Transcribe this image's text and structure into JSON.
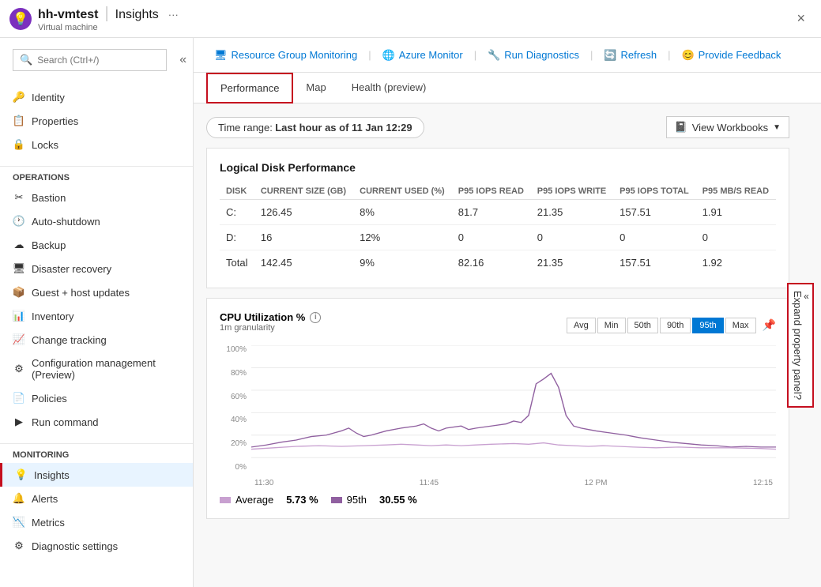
{
  "titleBar": {
    "iconChar": "💡",
    "resourceName": "hh-vmtest",
    "pageName": "Insights",
    "subTitle": "Virtual machine",
    "dotsLabel": "···",
    "closeLabel": "×"
  },
  "sidebar": {
    "searchPlaceholder": "Search (Ctrl+/)",
    "collapseLabel": "«",
    "topItems": [
      {
        "id": "identity",
        "label": "Identity",
        "icon": "🔑"
      },
      {
        "id": "properties",
        "label": "Properties",
        "icon": "📋"
      },
      {
        "id": "locks",
        "label": "Locks",
        "icon": "🔒"
      }
    ],
    "operations": {
      "title": "Operations",
      "items": [
        {
          "id": "bastion",
          "label": "Bastion",
          "icon": "⚙"
        },
        {
          "id": "auto-shutdown",
          "label": "Auto-shutdown",
          "icon": "🕐"
        },
        {
          "id": "backup",
          "label": "Backup",
          "icon": "☁"
        },
        {
          "id": "disaster-recovery",
          "label": "Disaster recovery",
          "icon": "🖥"
        },
        {
          "id": "guest-updates",
          "label": "Guest + host updates",
          "icon": "📦"
        },
        {
          "id": "inventory",
          "label": "Inventory",
          "icon": "📊"
        },
        {
          "id": "change-tracking",
          "label": "Change tracking",
          "icon": "📈"
        },
        {
          "id": "config-management",
          "label": "Configuration management (Preview)",
          "icon": "⚙"
        },
        {
          "id": "policies",
          "label": "Policies",
          "icon": "📄"
        },
        {
          "id": "run-command",
          "label": "Run command",
          "icon": "▶"
        }
      ]
    },
    "monitoring": {
      "title": "Monitoring",
      "items": [
        {
          "id": "insights",
          "label": "Insights",
          "icon": "💡",
          "active": true
        },
        {
          "id": "alerts",
          "label": "Alerts",
          "icon": "🔔"
        },
        {
          "id": "metrics",
          "label": "Metrics",
          "icon": "📉"
        },
        {
          "id": "diagnostic-settings",
          "label": "Diagnostic settings",
          "icon": "⚙"
        }
      ]
    }
  },
  "topNav": {
    "items": [
      {
        "id": "resource-group-monitoring",
        "label": "Resource Group Monitoring",
        "icon": "🖥"
      },
      {
        "id": "azure-monitor",
        "label": "Azure Monitor",
        "icon": "🌐"
      },
      {
        "id": "run-diagnostics",
        "label": "Run Diagnostics",
        "icon": "🔧"
      },
      {
        "id": "refresh",
        "label": "Refresh",
        "icon": "🔄"
      },
      {
        "id": "provide-feedback",
        "label": "Provide Feedback",
        "icon": "😊"
      }
    ]
  },
  "tabs": [
    {
      "id": "performance",
      "label": "Performance",
      "active": true
    },
    {
      "id": "map",
      "label": "Map",
      "active": false
    },
    {
      "id": "health",
      "label": "Health (preview)",
      "active": false
    }
  ],
  "timeRange": {
    "label": "Time range:",
    "value": "Last hour as of 11 Jan 12:29"
  },
  "viewWorkbooks": {
    "label": "View Workbooks"
  },
  "diskTable": {
    "title": "Logical Disk Performance",
    "columns": [
      "DISK",
      "CURRENT SIZE (GB)",
      "CURRENT USED (%)",
      "P95 IOPs READ",
      "P95 IOPs WRITE",
      "P95 IOPs TOTAL",
      "P95 MB/s READ"
    ],
    "rows": [
      {
        "disk": "C:",
        "size": "126.45",
        "used": "8%",
        "iopsRead": "81.7",
        "iopsWrite": "21.35",
        "iopsTotal": "157.51",
        "mbRead": "1.91"
      },
      {
        "disk": "D:",
        "size": "16",
        "used": "12%",
        "iopsRead": "0",
        "iopsWrite": "0",
        "iopsTotal": "0",
        "mbRead": "0"
      },
      {
        "disk": "Total",
        "size": "142.45",
        "used": "9%",
        "iopsRead": "82.16",
        "iopsWrite": "21.35",
        "iopsTotal": "157.51",
        "mbRead": "1.92"
      }
    ]
  },
  "cpuChart": {
    "title": "CPU Utilization %",
    "granularity": "1m granularity",
    "buttons": [
      "Avg",
      "Min",
      "50th",
      "90th",
      "95th",
      "Max"
    ],
    "activeButton": "95th",
    "yLabels": [
      "100%",
      "80%",
      "60%",
      "40%",
      "20%",
      "0%"
    ],
    "xLabels": [
      "11:30",
      "11:45",
      "12 PM",
      "12:15"
    ],
    "legend": [
      {
        "label": "Average",
        "value": "5.73 %",
        "color": "#c8a0d0"
      },
      {
        "label": "95th",
        "value": "30.55 %",
        "color": "#9060a0"
      }
    ]
  },
  "expandPanel": {
    "label": "Expand property panel?"
  }
}
